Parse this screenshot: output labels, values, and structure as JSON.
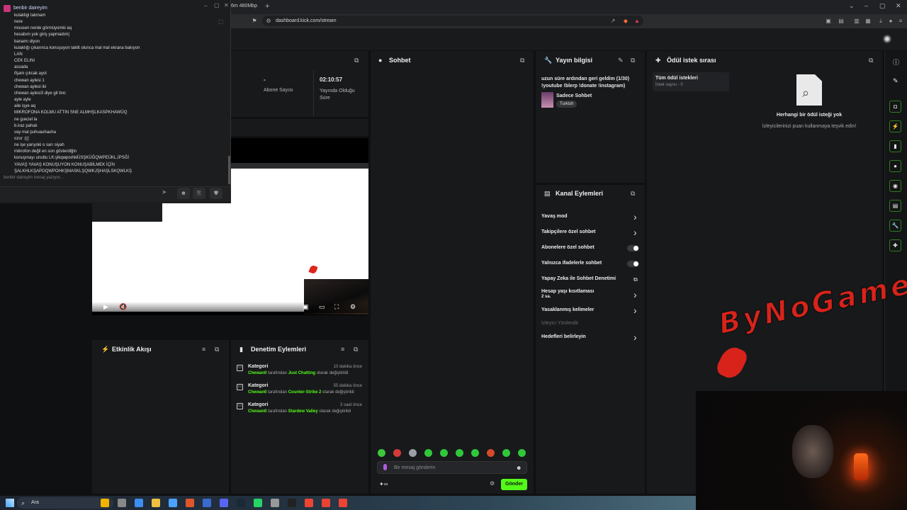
{
  "browser": {
    "tab_title": "6m 480Mbp",
    "new_tab": "+",
    "url": "dashboard.kick.com/stream",
    "controls": {
      "minimize": "–",
      "restore": "▢",
      "close": "✕",
      "chevron": "⌄"
    }
  },
  "popup_chat": {
    "title": "benbir daireyim",
    "messages": [
      "kulakligi takmam",
      "nere",
      "mousen nerde görmüyomki aq",
      "hesabım yok giriş yapmadım|",
      "banamı diyon",
      "kulaklığı çıkarınca konuşuyon taklit olunca mal mal ekrana bakıyon",
      "LAN",
      "CEK ELINI",
      "assada",
      "ifşam çıkcak ayol",
      "chewan aylesi 1",
      "chewan aylesi iki",
      "chewan aylesi3 diye git bnc",
      "ayle ayle",
      "aile işye aq",
      "MIKROFONA KOLMU ATTIN SNE ALMHŞLKASPKHAWÜQ",
      "ne guezel la",
      "b.iraz pahalı",
      "vay mal puhuauhauha",
      "ozur :(((",
      "ne işe yarıyoki o sarı siyah",
      "mikrofon değil en son gösterdiğin",
      "konuşmayı unuttu LK:şlkqwpoıhklÜSŞKÜĞQWPEÜKL,İPSĞİ",
      "YAVAŞ YAVAŞ KONUŞUYON KONUŞABİLMEK İÇİN",
      "ŞALKHLKŞAPOQWPOHKŞMASKLŞQWKJŞHAŞLSKQWLKŞ"
    ],
    "input_placeholder": "benbir daireyim mesaj yazıyor..."
  },
  "stats": {
    "subscribers_value": "-",
    "subscribers_label": "Abone Sayısı",
    "live_time_value": "02:10:57",
    "live_time_label": "Yayında Olduğu Süre"
  },
  "activity": {
    "title": "Etkinlik Akışı"
  },
  "moderation": {
    "title": "Denetim Eylemleri",
    "items": [
      {
        "head": "Kategori",
        "time": "10 dakika önce",
        "user": "Chewan0",
        "mid": " tarafından ",
        "target": "Just Chatting",
        "tail": " olarak değiştirildi"
      },
      {
        "head": "Kategori",
        "time": "55 dakika önce",
        "user": "Chewan0",
        "mid": " tarafından ",
        "target": "Counter-Strike 2",
        "tail": " olarak değiştirildi"
      },
      {
        "head": "Kategori",
        "time": "3 saat önce",
        "user": "Chewan0",
        "mid": " tarafından ",
        "target": "Stardew Valley",
        "tail": " olarak değiştirildi"
      }
    ]
  },
  "chat": {
    "title": "Sohbet",
    "input_placeholder": "Bir mesaj gönderin",
    "send_label": "Gönder",
    "points_label": "∞"
  },
  "stream_info": {
    "title": "Yayın bilgisi",
    "stream_title": "uzun süre ardından geri geldim (1/30) !youtube !blerp !donate !instagram)",
    "category": "Sadece Sohbet",
    "language": "Turkish"
  },
  "channel_actions": {
    "title": "Kanal Eylemleri",
    "items": [
      {
        "label": "Yavaş mod",
        "type": "chevron"
      },
      {
        "label": "Takipçilere özel sohbet",
        "type": "chevron"
      },
      {
        "label": "Abonelere özel sohbet",
        "type": "toggle"
      },
      {
        "label": "Yalnızca ifadelerle sohbet",
        "type": "toggle"
      },
      {
        "label": "Yapay Zeka ile Sohbet Denetimi",
        "type": "external"
      },
      {
        "label": "Hesap yaşı kısıtlaması",
        "type": "chevron",
        "sub": "2 sa."
      },
      {
        "label": "Yasaklanmış kelimeler",
        "type": "chevron"
      },
      {
        "label": "İzleyici Yönlendir",
        "type": "disabled"
      },
      {
        "label": "Hedefleri belirleyin",
        "type": "chevron"
      }
    ]
  },
  "rewards": {
    "title": "Ödül istek sırası",
    "tab_label": "Tüm ödül istekleri",
    "tab_sub": "İstek sayısı - 0",
    "empty_title": "Herhangi bir ödül isteği yok",
    "empty_sub": "İzleyicilerinizi puan kullanmaya teşvik edin!"
  },
  "overlay": {
    "brand": "ByNoGame"
  },
  "taskbar": {
    "search": "Ara"
  },
  "colors": {
    "accent": "#53fc18",
    "brand_red": "#d8231a",
    "panel": "#18191b"
  }
}
